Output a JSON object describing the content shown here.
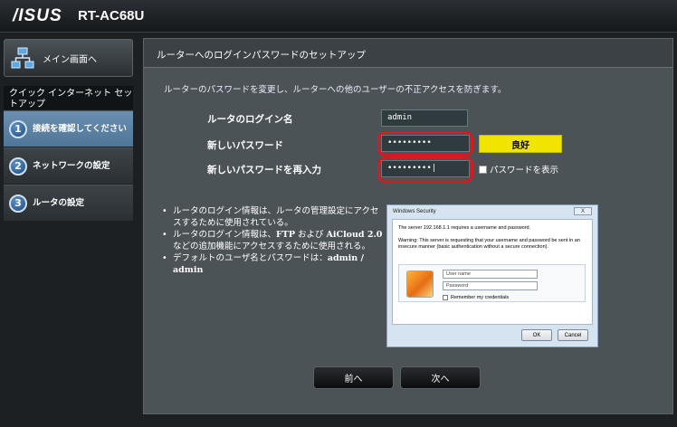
{
  "header": {
    "brand": "/ISUS",
    "model": "RT-AC68U"
  },
  "sidebar": {
    "main_button": "メイン画面へ",
    "qis_title": "クイック インターネット セットアップ",
    "steps": [
      {
        "num": "1",
        "label": "接続を確認してください",
        "active": true
      },
      {
        "num": "2",
        "label": "ネットワークの設定"
      },
      {
        "num": "3",
        "label": "ルータの設定"
      }
    ]
  },
  "panel": {
    "title": "ルーターへのログインパスワードのセットアップ",
    "intro": "ルーターのパスワードを変更し、ルーターへの他のユーザーの不正アクセスを防ぎます。",
    "login_name_label": "ルータのログイン名",
    "login_name_value": "admin",
    "new_password_label": "新しいパスワード",
    "new_password_value": "•••••••••",
    "confirm_password_label": "新しいパスワードを再入力",
    "confirm_password_value": "•••••••••|",
    "strength": "良好",
    "strength_color": "#f0e400",
    "show_password": "パスワードを表示",
    "bullets": {
      "b1": "ルータのログイン情報は、ルータの管理設定にアクセスするために使用されている。",
      "b2_pre": "ルータのログイン情報は、",
      "b2_ftp": "FTP",
      "b2_mid": " および ",
      "b2_aicloud": "AiCloud 2.0",
      "b2_post": " などの追加機能にアクセスするために使用される。",
      "b3_pre": "デフォルトのユーザ名とパスワードは：",
      "b3_creds": "admin / admin"
    }
  },
  "dialog": {
    "title": "Windows Security",
    "close": "X",
    "line1": "The server 192.168.1.1  requires a username and password.",
    "line2": "Warning: This server is requesting that your username and password be sent in an insecure manner (basic authentication without a secure connection).",
    "username_placeholder": "User name",
    "password_placeholder": "Password",
    "remember": "Remember my credentials",
    "ok": "OK",
    "cancel": "Cancel"
  },
  "nav": {
    "prev": "前へ",
    "next": "次へ"
  }
}
